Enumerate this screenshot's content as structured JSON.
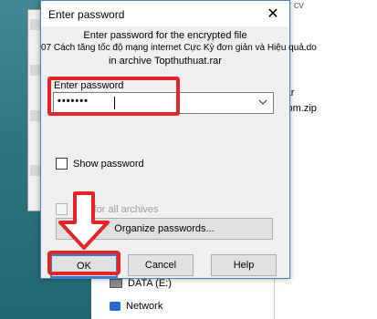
{
  "dialog": {
    "title": "Enter password",
    "message_line1": "Enter password for the encrypted file",
    "message_line2": "07 Cách tăng tốc độ mạng internet Cực Kỳ đơn giản và Hiệu quả.do",
    "message_line3": "in archive Topthuthuat.rar",
    "password_label": "Enter password",
    "password_value": "•••••••",
    "show_password_label": "Show password",
    "use_for_all_label": "Use for all archives",
    "organize_button": "Organize passwords...",
    "ok_button": "OK",
    "cancel_button": "Cancel",
    "help_button": "Help"
  },
  "explorer": {
    "top_item": "hr cv",
    "item_rar": "rar",
    "item_zip": "com.zip",
    "drive_label": "DATA (E:)",
    "network_label": "Network"
  },
  "annotation_color": "#e12626"
}
